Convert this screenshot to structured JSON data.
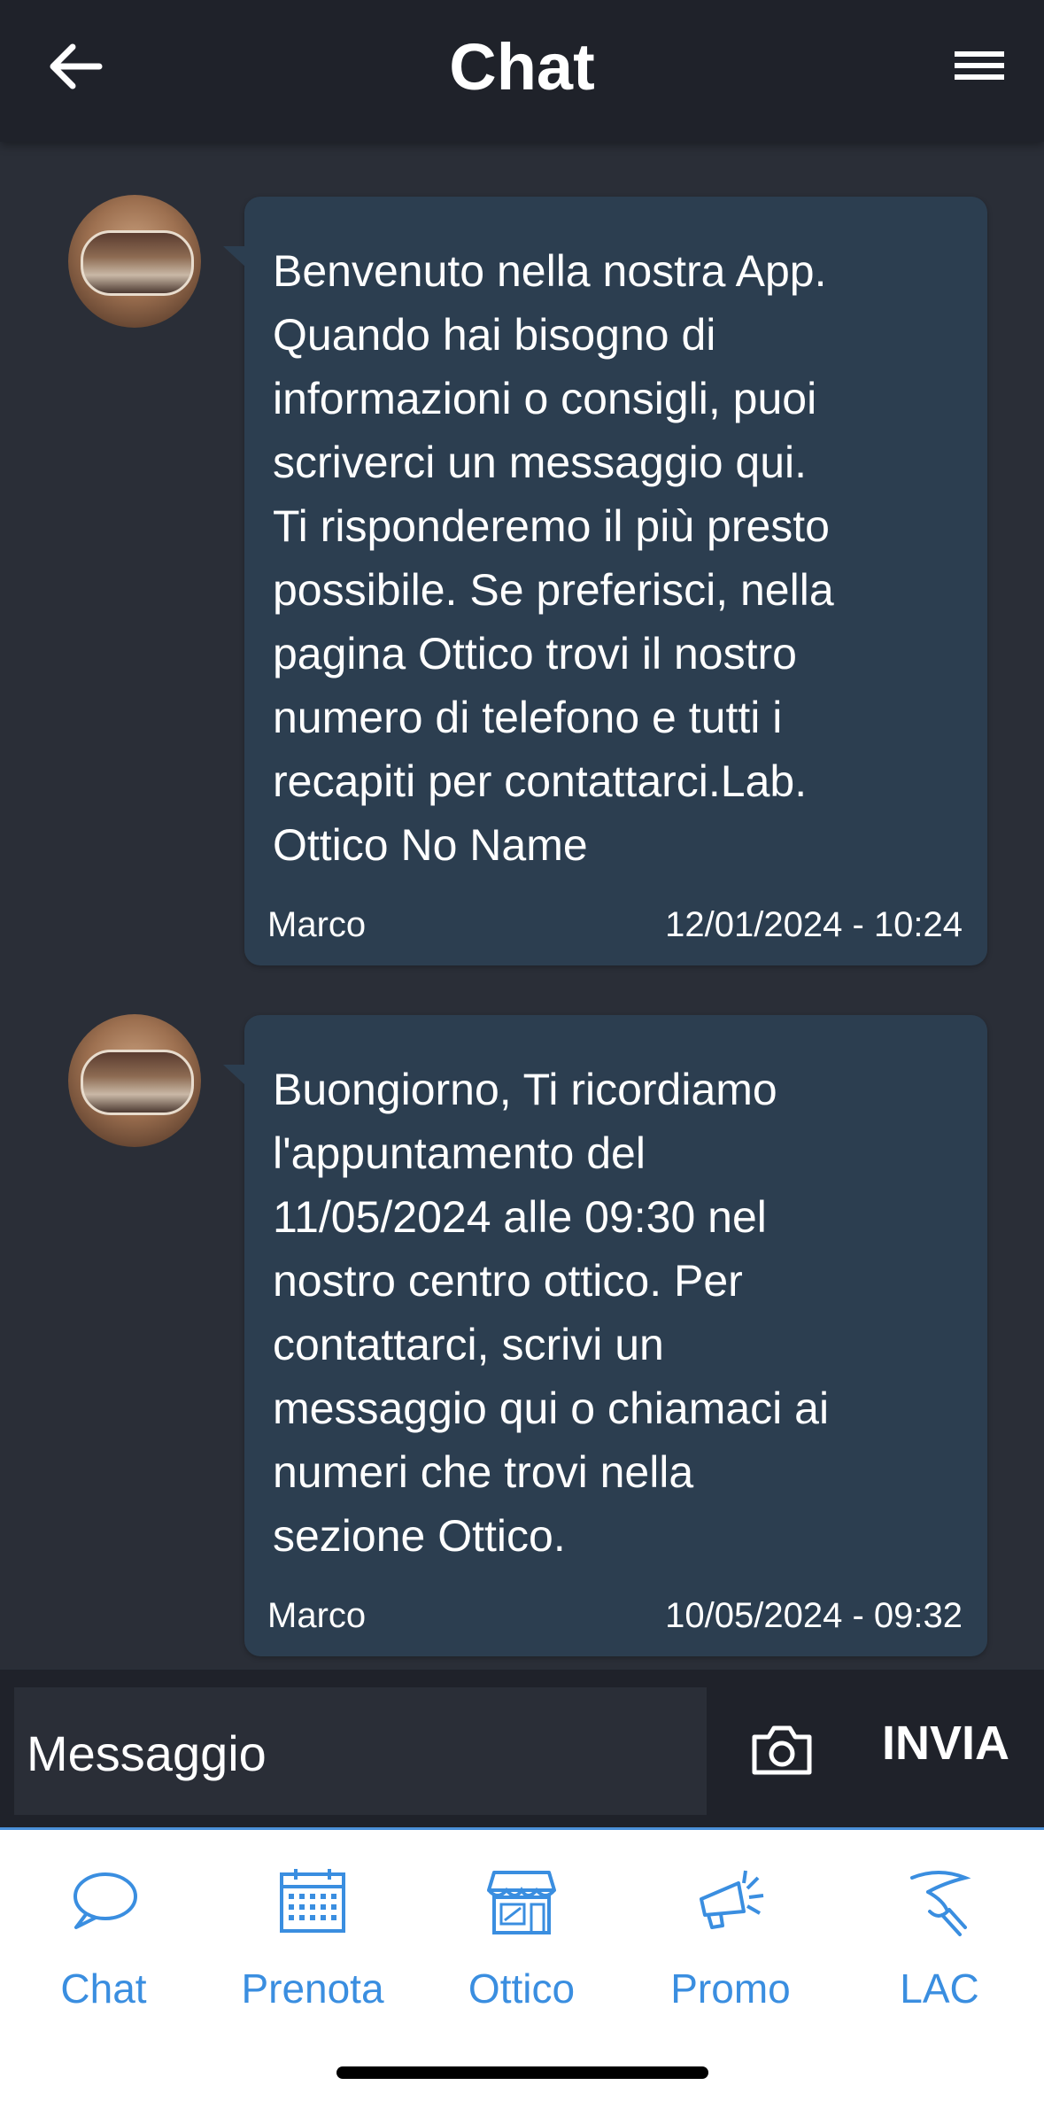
{
  "header": {
    "title": "Chat"
  },
  "messages": [
    {
      "text": "Benvenuto nella nostra App.\nQuando hai bisogno di\ninformazioni o consigli, puoi\nscriverci un messaggio qui.\nTi risponderemo il più presto\npossibile. Se preferisci, nella\npagina Ottico trovi il nostro\nnumero di telefono e tutti i\nrecapiti per contattarci.Lab.\nOttico No Name",
      "sender": "Marco",
      "timestamp": "12/01/2024 - 10:24"
    },
    {
      "text": "Buongiorno, Ti ricordiamo\nl'appuntamento del\n11/05/2024 alle 09:30 nel\nnostro centro ottico. Per\ncontattarci, scrivi un\nmessaggio qui o chiamaci ai\nnumeri che trovi nella\nsezione Ottico.",
      "sender": "Marco",
      "timestamp": "10/05/2024 - 09:32"
    }
  ],
  "composer": {
    "placeholder": "Messaggio",
    "send_label": "INVIA",
    "camera_icon": "camera-icon"
  },
  "tabs": [
    {
      "label": "Chat",
      "icon": "chat-bubble-icon"
    },
    {
      "label": "Prenota",
      "icon": "calendar-icon"
    },
    {
      "label": "Ottico",
      "icon": "store-icon"
    },
    {
      "label": "Promo",
      "icon": "megaphone-icon"
    },
    {
      "label": "LAC",
      "icon": "contact-lens-icon"
    }
  ],
  "colors": {
    "header_bg": "#1f222a",
    "page_bg": "#2a2e37",
    "bubble_bg": "#2c3e50",
    "tab_accent": "#3a8ee0"
  }
}
